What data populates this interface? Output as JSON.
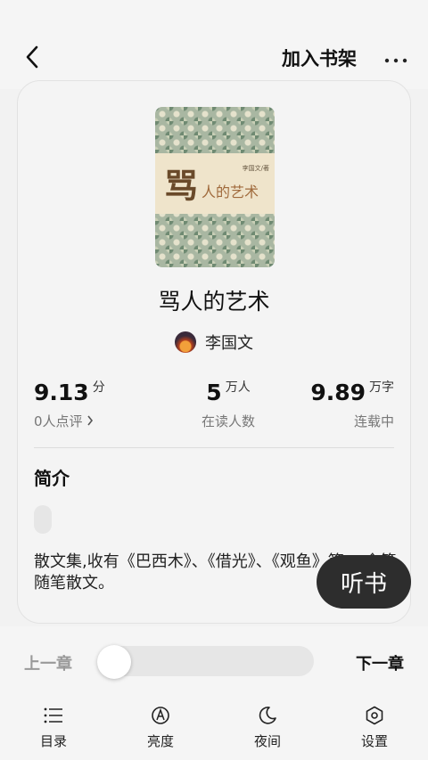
{
  "header": {
    "add_to_shelf": "加入书架",
    "back_icon": "chevron-left-icon",
    "more_icon": "more-horizontal-icon"
  },
  "book": {
    "cover_big_char": "骂",
    "cover_title": "人的艺术",
    "cover_author": "李国文/著",
    "title": "骂人的艺术",
    "author": "李国文"
  },
  "stats": {
    "score": {
      "value": "9.13",
      "unit": "分",
      "label": "0人点评"
    },
    "readers": {
      "value": "5",
      "unit": "万人",
      "label": "在读人数"
    },
    "words": {
      "value": "9.89",
      "unit": "万字",
      "label": "连载中"
    }
  },
  "intro": {
    "heading": "简介",
    "text": "散文集,收有《巴西木》、《借光》、《观鱼》等30余篇随笔散文。"
  },
  "listen_button": "听书",
  "reader_controls": {
    "prev_chapter": "上一章",
    "next_chapter": "下一章",
    "progress": 0
  },
  "tabs": [
    {
      "label": "目录",
      "icon": "list-icon"
    },
    {
      "label": "亮度",
      "icon": "brightness-icon"
    },
    {
      "label": "夜间",
      "icon": "moon-icon"
    },
    {
      "label": "设置",
      "icon": "settings-icon"
    }
  ]
}
